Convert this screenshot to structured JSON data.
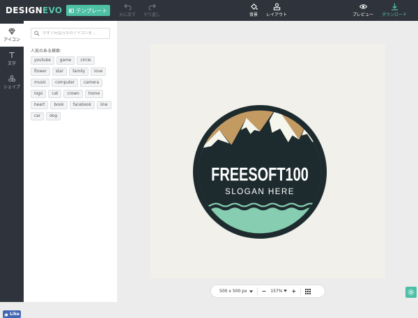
{
  "topbar": {
    "logo_part1": "DESIGN",
    "logo_part2": "EVO",
    "template_button": "テンプレート",
    "undo_label": "元に戻す",
    "redo_label": "やり直し",
    "background_label": "背景",
    "layout_label": "レイアウト",
    "preview_label": "プレビュー",
    "download_label": "ダウンロード"
  },
  "sidebar": {
    "items": [
      {
        "label": "アイコン",
        "icon": "diamond-icon",
        "active": true
      },
      {
        "label": "文字",
        "icon": "text-icon",
        "active": false
      },
      {
        "label": "シェイプ",
        "icon": "shapes-icon",
        "active": false
      }
    ],
    "like_button": "Like"
  },
  "panel": {
    "search_placeholder": "今すぐ何百万ものアイコンを...",
    "popular_label": "人気のある検索:",
    "tags": [
      "youtube",
      "game",
      "circle",
      "flower",
      "star",
      "family",
      "love",
      "music",
      "computer",
      "camera",
      "logo",
      "cat",
      "crown",
      "home",
      "heart",
      "book",
      "facebook",
      "line",
      "car",
      "dog"
    ]
  },
  "canvas": {
    "logo_title": "FREESOFT100",
    "logo_slogan": "SLOGAN HERE",
    "colors": {
      "artboard": "#f1f0ea",
      "ring": "#1d2b2e",
      "sky": "#c49a63",
      "mountain": "#1d2b2e",
      "snow": "#f5f6ec",
      "water": "#86cdb1"
    }
  },
  "bottombar": {
    "size_label": "500 x 500 px",
    "zoom_label": "157%"
  }
}
